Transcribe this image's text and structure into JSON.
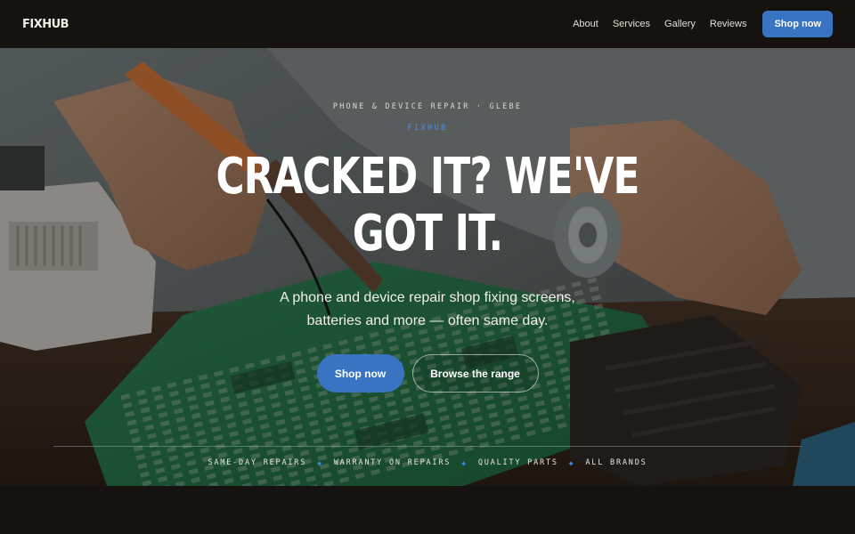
{
  "header": {
    "logo": "FIXHUB",
    "nav": [
      "About",
      "Services",
      "Gallery",
      "Reviews"
    ],
    "cta": "Shop now"
  },
  "hero": {
    "kicker": "PHONE & DEVICE REPAIR · GLEBE",
    "brand": "FIXHUB",
    "headline_line1": "CRACKED IT? WE'VE",
    "headline_line2": "GOT IT.",
    "sub_line1": "A phone and device repair shop fixing screens,",
    "sub_line2": "batteries and more — often same day.",
    "primary_button": "Shop now",
    "secondary_button": "Browse the range"
  },
  "features": [
    "SAME-DAY REPAIRS",
    "WARRANTY ON REPAIRS",
    "QUALITY PARTS",
    "ALL BRANDS"
  ],
  "colors": {
    "accent": "#3874c1",
    "background": "#15120f",
    "brand_text": "#4f8fdd"
  }
}
